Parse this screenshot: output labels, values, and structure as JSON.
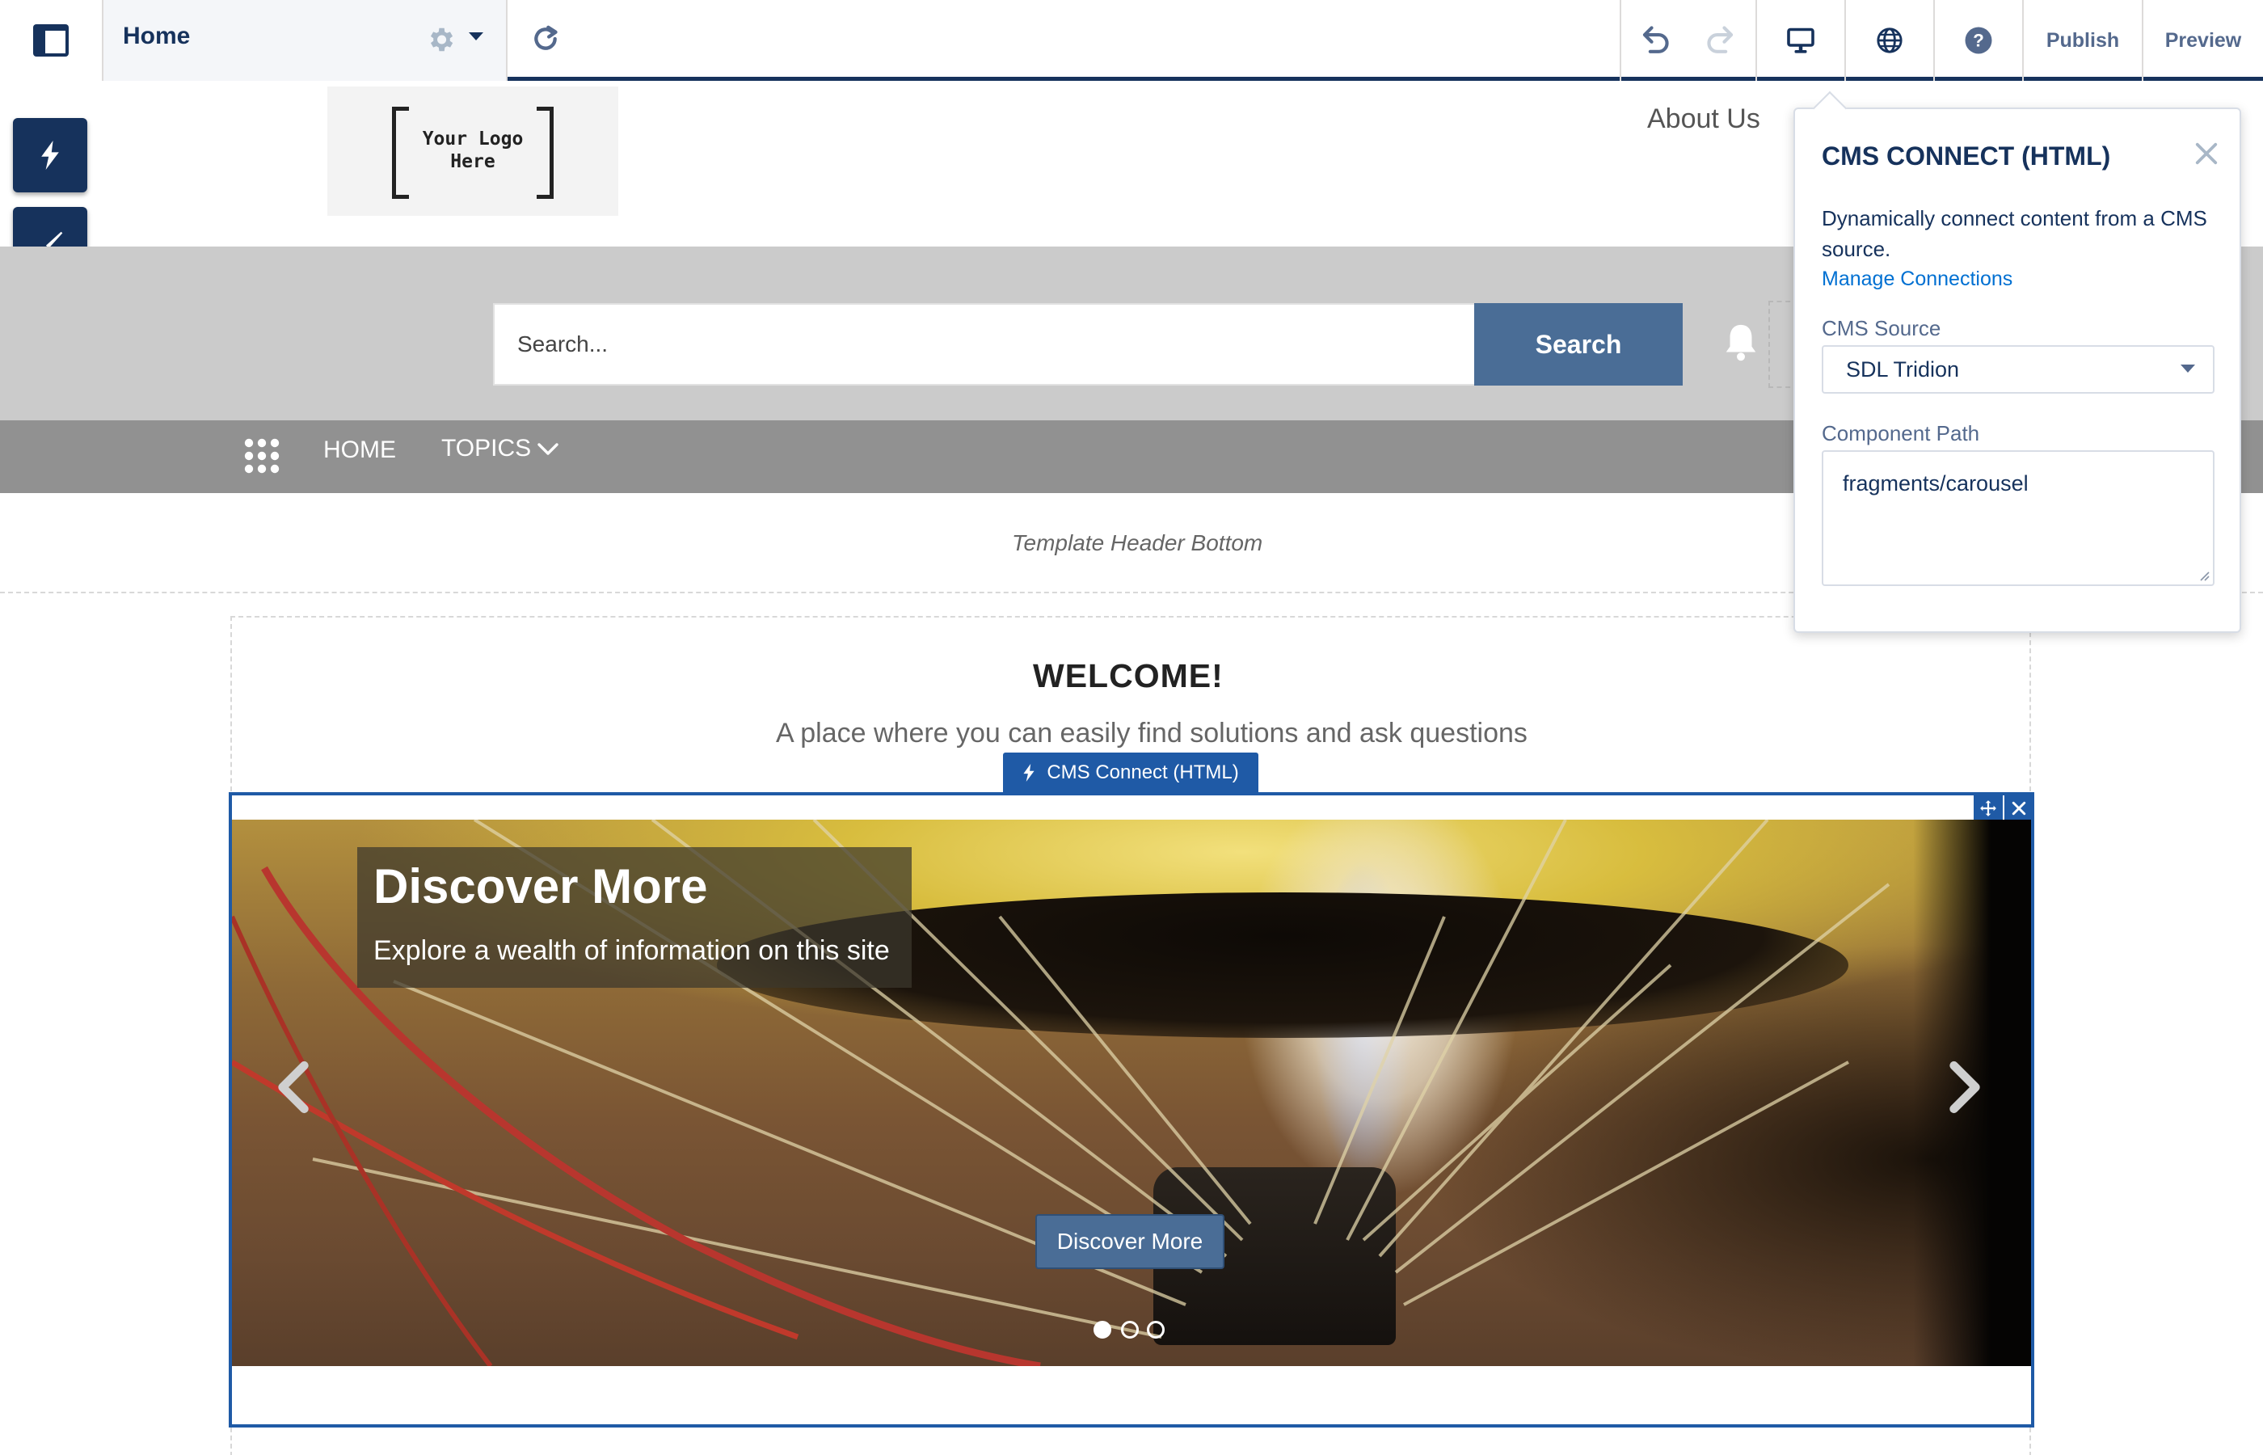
{
  "toolbar": {
    "page_name": "Home",
    "publish_label": "Publish",
    "preview_label": "Preview"
  },
  "site": {
    "logo_line1": "Your Logo",
    "logo_line2": "Here",
    "about_us": "About Us",
    "search_placeholder": "Search...",
    "search_button": "Search",
    "nav": {
      "home": "HOME",
      "topics": "TOPICS"
    },
    "template_header_bottom": "Template Header Bottom",
    "welcome": "WELCOME!",
    "tagline": "A place where you can easily find solutions and ask questions"
  },
  "component": {
    "tag_label": "CMS Connect (HTML)"
  },
  "carousel": {
    "title": "Discover More",
    "subtitle": "Explore a wealth of information on this site",
    "cta": "Discover More",
    "slide_count": 3,
    "active_slide": 1
  },
  "panel": {
    "title": "CMS CONNECT (HTML)",
    "description": "Dynamically connect content from a CMS source.",
    "link": "Manage Connections",
    "source_label": "CMS Source",
    "source_value": "SDL Tridion",
    "path_label": "Component Path",
    "path_value": "fragments/carousel"
  },
  "colors": {
    "navy": "#16325c",
    "accent_blue": "#1f5aa6",
    "button_blue": "#4a6d96",
    "link_blue": "#0070d2"
  },
  "icons": {
    "apps": "layout-icon",
    "settings": "gear-icon",
    "refresh": "refresh-icon",
    "undo": "undo-icon",
    "redo": "redo-icon",
    "device": "desktop-icon",
    "language": "globe-icon",
    "help": "help-icon"
  }
}
